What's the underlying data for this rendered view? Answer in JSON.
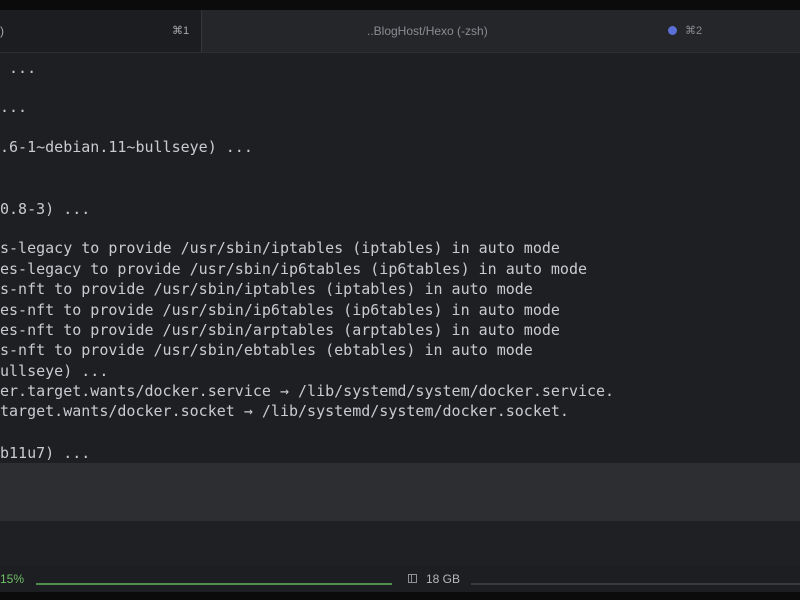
{
  "tabs": [
    {
      "title": ")",
      "shortcut": "⌘1",
      "active": true
    },
    {
      "title": "..BlogHost/Hexo (-zsh)",
      "shortcut": "⌘2",
      "active": false,
      "indicator_color": "#5b6fd6"
    }
  ],
  "terminal": {
    "lines": [
      " ...",
      "...",
      ".6-1~debian.11~bullseye) ...",
      "0.8-3) ...",
      "s-legacy to provide /usr/sbin/iptables (iptables) in auto mode",
      "es-legacy to provide /usr/sbin/ip6tables (ip6tables) in auto mode",
      "s-nft to provide /usr/sbin/iptables (iptables) in auto mode",
      "es-nft to provide /usr/sbin/ip6tables (ip6tables) in auto mode",
      "es-nft to provide /usr/sbin/arptables (arptables) in auto mode",
      "s-nft to provide /usr/sbin/ebtables (ebtables) in auto mode",
      "ullseye) ...",
      "er.target.wants/docker.service → /lib/systemd/system/docker.service.",
      "target.wants/docker.socket → /lib/systemd/system/docker.socket.",
      "b11u7) ..."
    ]
  },
  "statusbar": {
    "cpu_label": "15%",
    "cpu_fraction": 1.0,
    "disk_label": "18 GB",
    "disk_icon": "disk-icon",
    "cpu_color": "#6fbf6a"
  }
}
